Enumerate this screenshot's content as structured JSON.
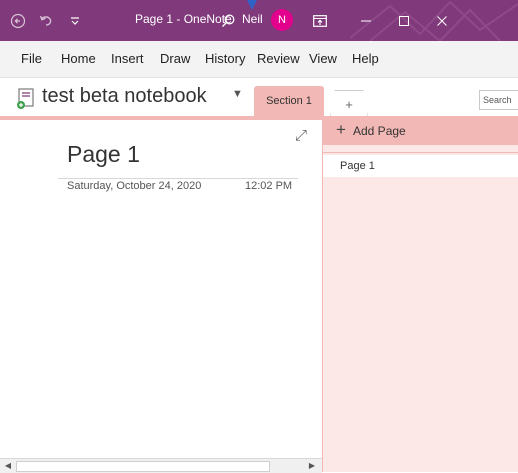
{
  "titlebar": {
    "title": "Page 1  -  OneNote",
    "user_name": "Neil",
    "avatar_initial": "N",
    "background": "#80397b",
    "avatar_color": "#e3008c",
    "icons": [
      "back-icon",
      "undo-icon",
      "quick-access-dropdown-icon",
      "search-icon",
      "ribbon-display-icon",
      "minimize-icon",
      "maximize-icon",
      "close-icon"
    ]
  },
  "menu": {
    "items": [
      "File",
      "Home",
      "Insert",
      "Draw",
      "History",
      "Review",
      "View",
      "Help"
    ]
  },
  "notebook": {
    "name": "test beta notebook",
    "section_tab": "Section 1",
    "add_section": "+",
    "search_placeholder": "Search",
    "section_color": "#f2b8b5"
  },
  "page": {
    "title": "Page 1",
    "date": "Saturday, October 24, 2020",
    "time": "12:02 PM"
  },
  "pages_panel": {
    "add_page_label": "Add Page",
    "pages": [
      "Page 1"
    ],
    "background": "#fce8e7"
  }
}
